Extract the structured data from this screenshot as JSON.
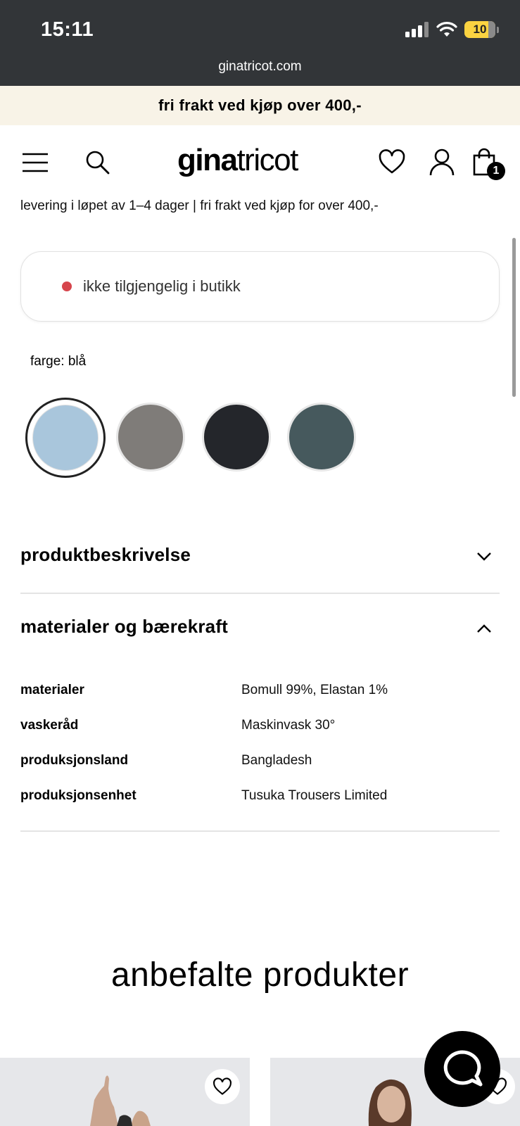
{
  "status_bar": {
    "time": "15:11",
    "battery": "10",
    "url": "ginatricot.com"
  },
  "promo_banner": "fri frakt ved kjøp over 400,-",
  "header": {
    "logo_bold": "gina",
    "logo_light": "tricot",
    "cart_count": "1"
  },
  "delivery_info": "levering i løpet av 1–4 dager | fri frakt ved kjøp for over 400,-",
  "stock": {
    "text": "ikke tilgjengelig i butikk",
    "status_color": "#d6454c"
  },
  "color": {
    "label": "farge: blå",
    "swatches": [
      {
        "name": "blå",
        "color": "#a9c6dc",
        "selected": true
      },
      {
        "name": "grå",
        "color": "#7f7c79",
        "selected": false
      },
      {
        "name": "svart",
        "color": "#24262b",
        "selected": false
      },
      {
        "name": "grønn",
        "color": "#46595d",
        "selected": false
      }
    ]
  },
  "accordions": [
    {
      "title": "produktbeskrivelse",
      "expanded": false
    },
    {
      "title": "materialer og bærekraft",
      "expanded": true
    }
  ],
  "specs": [
    {
      "label": "materialer",
      "value": "Bomull 99%, Elastan 1%"
    },
    {
      "label": "vaskeråd",
      "value": "Maskinvask 30°"
    },
    {
      "label": "produksjonsland",
      "value": "Bangladesh"
    },
    {
      "label": "produksjonsenhet",
      "value": "Tusuka Trousers Limited"
    }
  ],
  "recommended_title": "anbefalte produkter"
}
